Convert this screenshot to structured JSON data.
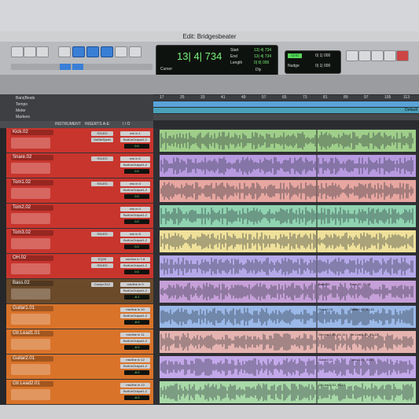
{
  "window": {
    "title": "Edit: Bridgesbeater"
  },
  "counter": {
    "main": "13| 4| 734",
    "label": "Cursor",
    "start_label": "Start",
    "end_label": "End",
    "length_label": "Length",
    "start": "13| 4| 734",
    "end": "13| 4| 734",
    "length": "0| 0| 000",
    "dly": "Dly"
  },
  "grid": {
    "grid_label": "Grid",
    "nudge_label": "Nudge",
    "grid_value": "0| 1| 000",
    "nudge_value": "0| 1| 000"
  },
  "rows": {
    "bars_beats": "Bars|Beats",
    "tempo": "Tempo",
    "meter": "Meter",
    "markers": "Markers",
    "default_label": "Default"
  },
  "columns": {
    "instrument": "INSTRUMENT",
    "inserts": "INSERTS A-E",
    "io": "I / O"
  },
  "ruler": [
    "17",
    "25",
    "33",
    "41",
    "49",
    "57",
    "65",
    "73",
    "81",
    "89",
    "97",
    "105",
    "113"
  ],
  "tracks": [
    {
      "name": "Kick.02",
      "insert": "SSLEG",
      "insert2": "DeMixSynth",
      "io": "mic in 1",
      "io2": "Built-inOutput1-2",
      "vol": "0.0"
    },
    {
      "name": "Snare.02",
      "insert": "SSLEG",
      "insert2": "",
      "io": "mic in 2",
      "io2": "Built-inOutput1-2",
      "vol": "0.0"
    },
    {
      "name": "Tom1.02",
      "insert": "SSLEG",
      "insert2": "",
      "io": "mic in 3",
      "io2": "Built-inOutput1-2",
      "vol": "0.0"
    },
    {
      "name": "Tom2.02",
      "insert": "",
      "insert2": "",
      "io": "mic in 4",
      "io2": "Built-inOutput1-2",
      "vol": "0.0"
    },
    {
      "name": "Tom3.02",
      "insert": "SSLEG",
      "insert2": "",
      "io": "mic in 5",
      "io2": "Built-inOutput1-2",
      "vol": "0.0"
    },
    {
      "name": "OH.02",
      "insert": "EQ3S",
      "insert2": "SSLEG",
      "io": "mic/line in 7-8",
      "io2": "Built-inOutput1-2",
      "vol": "0.0"
    },
    {
      "name": "Bass.02",
      "insert": "Compr.S12",
      "insert2": "",
      "io": "mic/line in 9",
      "io2": "Built-inOutput1-2",
      "vol": "-6.1"
    },
    {
      "name": "Guitar1.01",
      "insert": "",
      "insert2": "",
      "io": "mic/line in 10",
      "io2": "Built-inOutput1-2",
      "vol": "-6.0"
    },
    {
      "name": "Gtr.Lead1.01",
      "insert": "",
      "insert2": "",
      "io": "mic/line in 11",
      "io2": "Built-inOutput1-2",
      "vol": "-6.0"
    },
    {
      "name": "Guitar2.01",
      "insert": "",
      "insert2": "",
      "io": "mic/line in 12",
      "io2": "Built-inOutput1-2",
      "vol": "-6.0"
    },
    {
      "name": "Gtr.Lead2.01",
      "insert": "",
      "insert2": "",
      "io": "mic/line in 13",
      "io2": "Built-inOutput1-2",
      "vol": "-6.0"
    }
  ],
  "clips": [
    {
      "label": "Bass.05",
      "label2": "Bass.02_01-01"
    },
    {
      "label": "Guitar1.01",
      "label2": "Guitar1.01_01-01"
    },
    {
      "label": "GtrLead1.01_01-11",
      "label2": "Gtr.Lead1.01_01-12"
    },
    {
      "label": "Guitar2.01",
      "label2": "Guitar2.01_01-01"
    },
    {
      "label": "GtrLead2.01_01-01",
      "label2": ""
    }
  ],
  "colors": {
    "drums_red": "#c8352d",
    "bass_brown": "#6b4a2a",
    "guitar_orange": "#d9732a",
    "selection_blue": "#3a7fd6",
    "lcd_green": "#7af07a"
  }
}
